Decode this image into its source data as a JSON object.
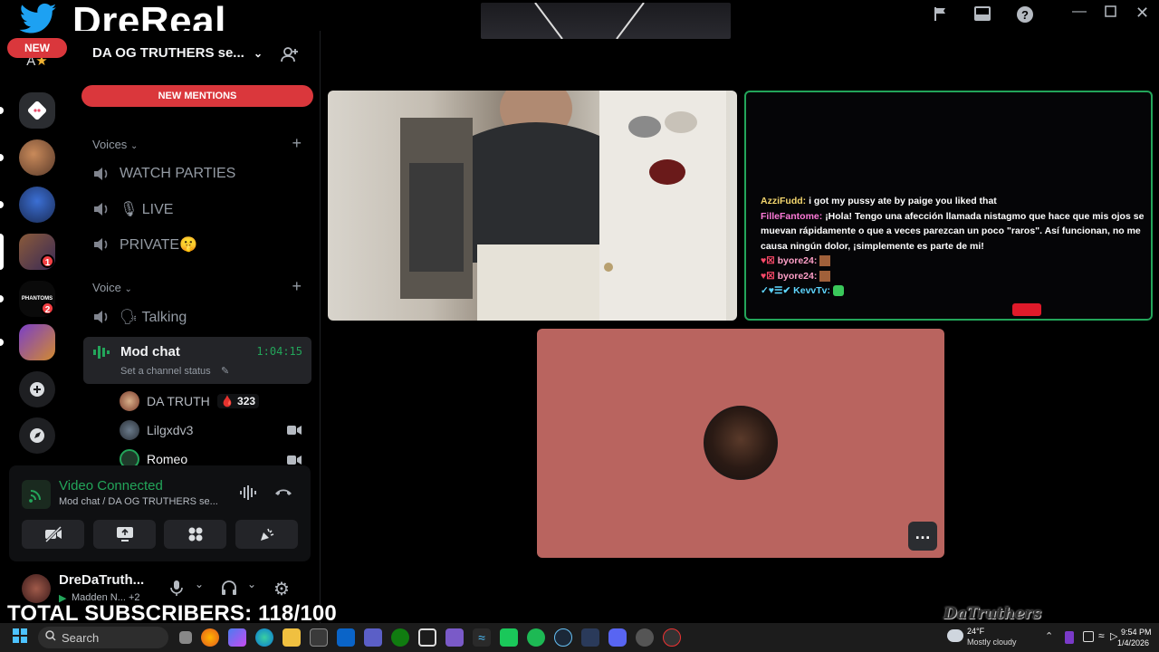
{
  "overlay": {
    "twitter_handle": "DreReal_",
    "new_badge": "NEW",
    "subscribers": "TOTAL SUBSCRIBERS: 118/100",
    "watermark": "DaTruthers"
  },
  "rail": {
    "badges": [
      "1",
      "2"
    ]
  },
  "server": {
    "name": "DA OG TRUTHERS se...",
    "new_mentions": "NEW MENTIONS",
    "categories": {
      "voices": "Voices",
      "voice": "Voice"
    },
    "channels": [
      {
        "label": "WATCH PARTIES"
      },
      {
        "label": "🎙 LIVE"
      },
      {
        "label": "PRIVATE🤫"
      }
    ],
    "talking": "🗣 Talking",
    "mod_chat": {
      "name": "Mod chat",
      "timer": "1:04:15",
      "status": "Set a channel status"
    },
    "members": [
      {
        "name": "DA TRUTH",
        "extra": "🩸 323"
      },
      {
        "name": "Lilgxdv3"
      },
      {
        "name": "Romeo"
      }
    ]
  },
  "voice_panel": {
    "status": "Video Connected",
    "location": "Mod chat / DA OG TRUTHERS se..."
  },
  "user": {
    "name": "DreDaTruth...",
    "activity": "Madden N... +2"
  },
  "stream_chat": [
    {
      "user": "AzziFudd:",
      "msg": "i got my pussy ate by paige you liked that",
      "color": "#f5d76e"
    },
    {
      "user": "FilleFantome:",
      "msg": "¡Hola! Tengo una afección llamada nistagmo que hace que mis ojos se muevan rápidamente o que a veces parezcan un poco \"raros\". Así funcionan, no me causa ningún dolor, ¡simplemente es parte de mi!",
      "color": "#ff7ad9"
    },
    {
      "user": "byore24:",
      "msg": "",
      "color": "#ff9fc7"
    },
    {
      "user": "byore24:",
      "msg": "",
      "color": "#ff9fc7"
    },
    {
      "user": "KevvTv:",
      "msg": "",
      "color": "#5fd7ff"
    }
  ],
  "taskbar": {
    "search": "Search",
    "weather_temp": "24°F",
    "weather_desc": "Mostly cloudy",
    "time": "9:54 PM",
    "date": "1/4/2026"
  },
  "colors": {
    "accent_green": "#23a55a",
    "mention_red": "#da373c",
    "tile_pink": "#b9645f"
  }
}
